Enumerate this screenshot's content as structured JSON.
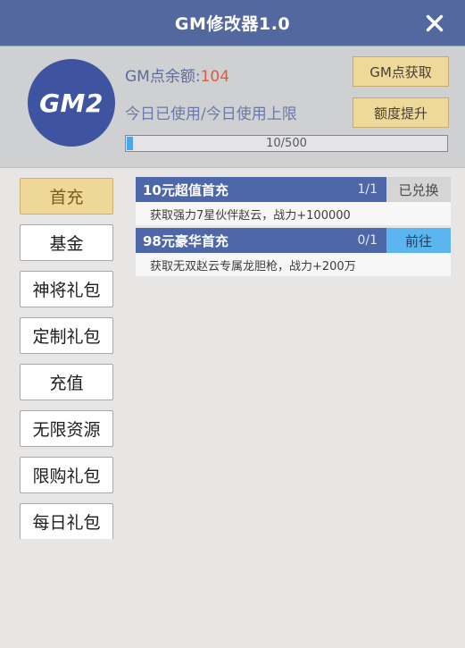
{
  "titlebar": {
    "title": "GM修改器1.0",
    "close_icon": "close-icon"
  },
  "header": {
    "avatar_label": "GM2",
    "balance_label": "GM点余额：",
    "balance_prefix": "GM点余额:",
    "balance_value": "104",
    "usage_label": "今日已使用/今日使用上限",
    "progress_text": "10/500",
    "progress_current": 10,
    "progress_max": 500,
    "buttons": [
      {
        "label": "GM点获取"
      },
      {
        "label": "额度提升"
      }
    ]
  },
  "sidebar": {
    "items": [
      {
        "label": "首充",
        "active": true
      },
      {
        "label": "基金",
        "active": false
      },
      {
        "label": "神将礼包",
        "active": false
      },
      {
        "label": "定制礼包",
        "active": false
      },
      {
        "label": "充值",
        "active": false
      },
      {
        "label": "无限资源",
        "active": false
      },
      {
        "label": "限购礼包",
        "active": false
      },
      {
        "label": "每日礼包",
        "active": false
      }
    ]
  },
  "main": {
    "packs": [
      {
        "name": "10元超值首充",
        "count": "1/1",
        "action": "已兑换",
        "action_state": "done",
        "desc": "获取强力7星伙伴赵云，战力+100000"
      },
      {
        "name": "98元豪华首充",
        "count": "0/1",
        "action": "前往",
        "action_state": "go",
        "desc": "获取无双赵云专属龙胆枪，战力+200万"
      }
    ]
  },
  "colors": {
    "titlebar": "#53689e",
    "header_panel": "#cfd0d2",
    "body": "#e8e6e4",
    "avatar": "#3f54a0",
    "accent_button": "#efd99a",
    "pack_head": "#4e67a8",
    "action_go": "#5bb6f0",
    "action_done": "#d5d5d5",
    "balance_value": "#e05a3a",
    "progress_fill": "#4aa8e8"
  }
}
